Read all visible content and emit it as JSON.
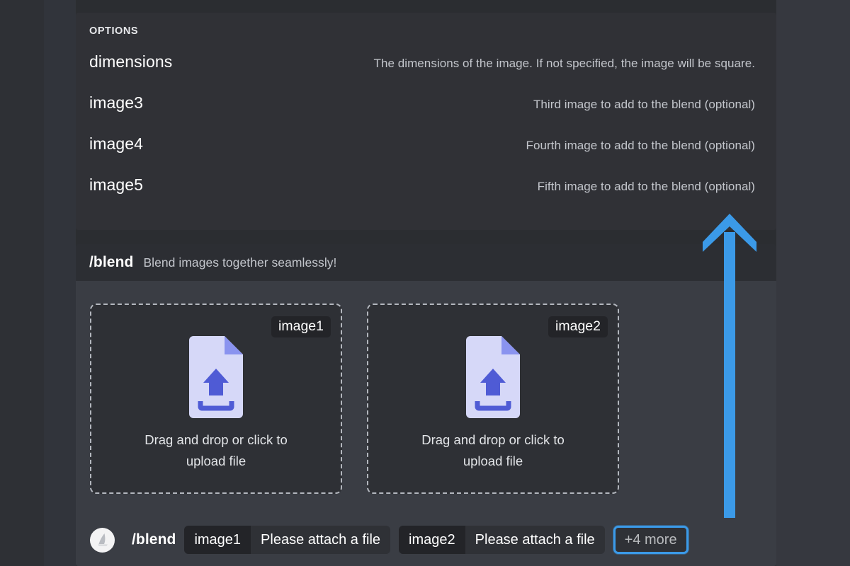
{
  "theme": {
    "page_bg": "#2b2d31",
    "options_panel_bg": "#303136",
    "command_header_bg": "#2c2e33",
    "command_body_bg": "#3a3d44",
    "dropzone_bg": "#2e3035",
    "dashed_border": "#b3b7be",
    "accent_blue": "#3b9ae8",
    "icon_page": "#d6d8f8",
    "icon_fold": "#8a93ef",
    "icon_arrow": "#4f5bd5",
    "muted_text": "#c3c6cc"
  },
  "options": {
    "title": "OPTIONS",
    "rows": [
      {
        "name": "dimensions",
        "description": "The dimensions of the image. If not specified, the image will be square."
      },
      {
        "name": "image3",
        "description": "Third image to add to the blend (optional)"
      },
      {
        "name": "image4",
        "description": "Fourth image to add to the blend (optional)"
      },
      {
        "name": "image5",
        "description": "Fifth image to add to the blend (optional)"
      }
    ]
  },
  "command": {
    "name": "/blend",
    "description": "Blend images together seamlessly!",
    "dropzones": [
      {
        "badge": "image1",
        "icon": "file-upload-icon",
        "text": "Drag and drop or click to upload file"
      },
      {
        "badge": "image2",
        "icon": "file-upload-icon",
        "text": "Drag and drop or click to upload file"
      }
    ]
  },
  "command_bar": {
    "avatar_icon": "sail-avatar-icon",
    "command": "/blend",
    "args": [
      {
        "key": "image1",
        "value": "Please attach a file"
      },
      {
        "key": "image2",
        "value": "Please attach a file"
      }
    ],
    "more_label": "+4 more"
  },
  "annotation": {
    "arrow_icon": "up-arrow-annotation",
    "color": "#3b9ae8",
    "points_to": "+4 more"
  }
}
